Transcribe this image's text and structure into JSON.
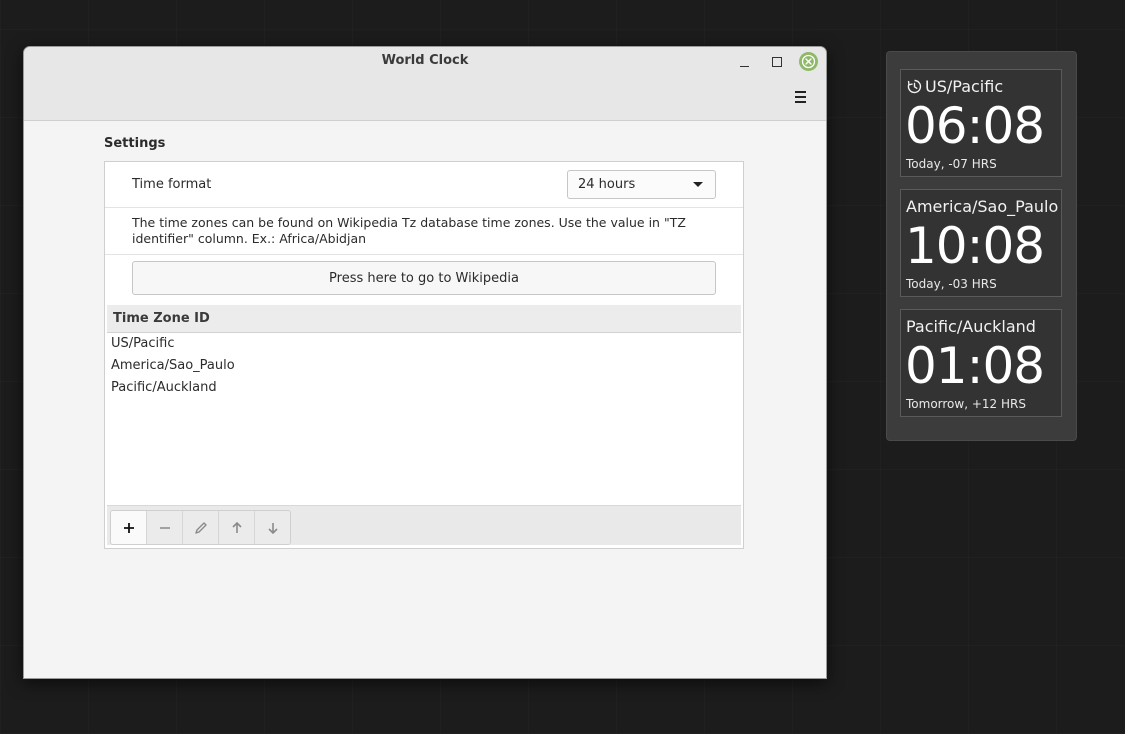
{
  "window": {
    "title": "World Clock"
  },
  "settings": {
    "title": "Settings",
    "time_format_label": "Time format",
    "time_format_value": "24 hours",
    "info_text": "The time zones can be found on Wikipedia Tz database time zones. Use the value in \"TZ identifier\" column. Ex.: Africa/Abidjan",
    "wiki_button_label": "Press here to go to Wikipedia"
  },
  "timezone_list": {
    "header": "Time Zone ID",
    "rows": [
      "US/Pacific",
      "America/Sao_Paulo",
      "Pacific/Auckland"
    ]
  },
  "toolbar": {
    "icons": [
      "add-icon",
      "remove-icon",
      "edit-icon",
      "move-up-icon",
      "move-down-icon"
    ]
  },
  "desklet": {
    "clocks": [
      {
        "zone": "US/Pacific",
        "time": "06:08",
        "diff": "Today, -07 HRS",
        "icon": "timer-icon"
      },
      {
        "zone": "America/Sao_Paulo",
        "time": "10:08",
        "diff": "Today, -03 HRS"
      },
      {
        "zone": "Pacific/Auckland",
        "time": "01:08",
        "diff": "Tomorrow, +12 HRS"
      }
    ]
  },
  "colors": {
    "close_button": "#8fb869",
    "desklet_background": "#3c3c3c",
    "window_background": "#f4f4f4"
  }
}
